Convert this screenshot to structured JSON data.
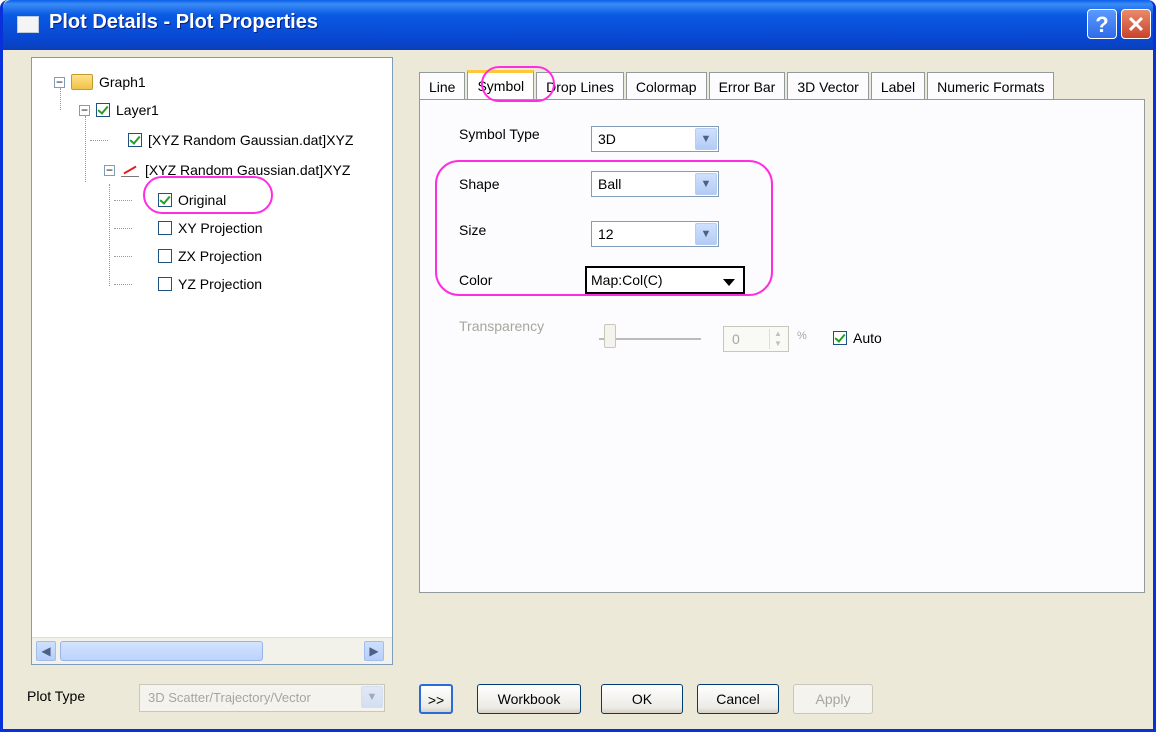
{
  "window": {
    "title": "Plot Details - Plot Properties",
    "help_label": "?",
    "close_label": "✕"
  },
  "tree": {
    "root": "Graph1",
    "layer": "Layer1",
    "plot1": "[XYZ Random Gaussian.dat]XYZ",
    "plot2": "[XYZ Random Gaussian.dat]XYZ",
    "children": [
      "Original",
      "XY Projection",
      "ZX Projection",
      "YZ Projection"
    ]
  },
  "tabs": [
    "Line",
    "Symbol",
    "Drop Lines",
    "Colormap",
    "Error Bar",
    "3D Vector",
    "Label",
    "Numeric Formats"
  ],
  "symbol": {
    "type_label": "Symbol Type",
    "type_value": "3D",
    "shape_label": "Shape",
    "shape_value": "Ball",
    "size_label": "Size",
    "size_value": "12",
    "color_label": "Color",
    "color_value": "Map:Col(C)",
    "transparency_label": "Transparency",
    "transparency_value": "0",
    "percent": "%",
    "auto_label": "Auto"
  },
  "footer": {
    "plot_type_label": "Plot Type",
    "plot_type_value": "3D Scatter/Trajectory/Vector",
    "more_label": ">>",
    "workbook_label": "Workbook",
    "ok_label": "OK",
    "cancel_label": "Cancel",
    "apply_label": "Apply"
  },
  "colors": {
    "title_blue": "#0a5ae3",
    "annotation": "#ff2de2",
    "tab_highlight": "#ffc83c"
  }
}
